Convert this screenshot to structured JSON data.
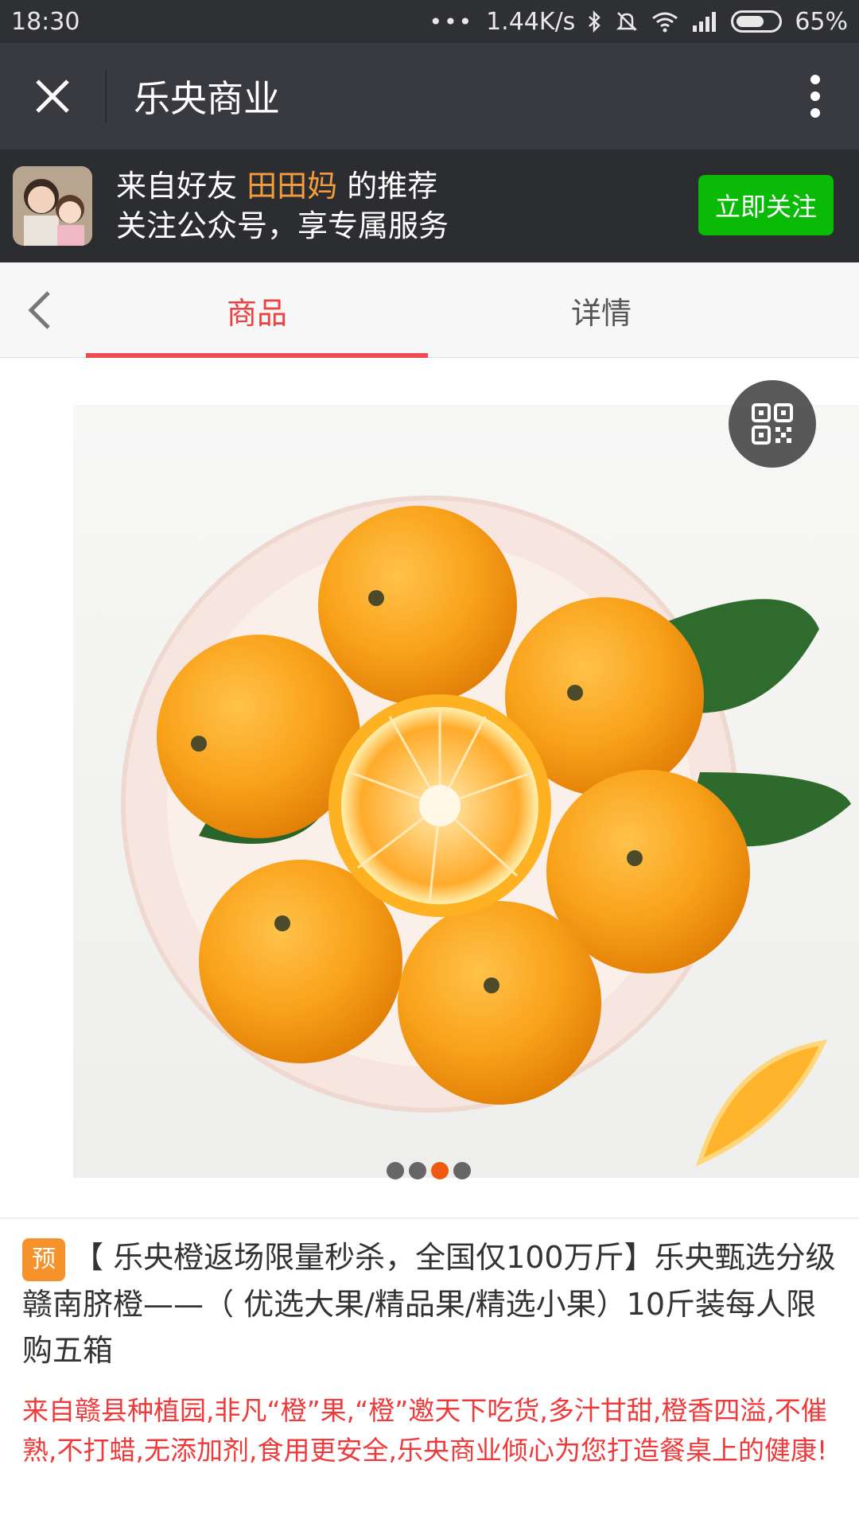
{
  "status_bar": {
    "time": "18:30",
    "dots": "•••",
    "network_speed": "1.44K/s",
    "battery_percent": "65%",
    "battery_level": 0.65,
    "icons": [
      "bluetooth-icon",
      "mute-icon",
      "wifi-icon",
      "signal-icon",
      "battery-icon"
    ]
  },
  "title_bar": {
    "title": "乐央商业",
    "close_icon": "close-icon",
    "more_icon": "more-vertical-icon"
  },
  "recommendation": {
    "prefix": "来自好友 ",
    "friend_name": "田田妈",
    "suffix": " 的推荐",
    "line2": "关注公众号，享专属服务",
    "follow_label": "立即关注"
  },
  "tabs": {
    "items": [
      {
        "label": "商品",
        "active": true
      },
      {
        "label": "详情",
        "active": false
      }
    ]
  },
  "gallery": {
    "page_count": 4,
    "active_index": 2
  },
  "product": {
    "badge": "预",
    "title": "【 乐央橙返场限量秒杀，全国仅100万斤】乐央甄选分级赣南脐橙——（ 优选大果/精品果/精选小果）10斤装每人限购五箱",
    "description": "来自赣县种植园,非凡“橙”果,“橙”邀天下吃货,多汁甘甜,橙香四溢,不催熟,不打蜡,无添加剂,食用更安全,乐央商业倾心为您打造餐桌上的健康!"
  },
  "colors": {
    "accent": "#ee4040",
    "follow_green": "#09bb07",
    "friend_orange": "#f59d3a",
    "badge_orange": "#f5922c",
    "description_red": "#ee3a3a",
    "pager_active": "#f05a10"
  }
}
